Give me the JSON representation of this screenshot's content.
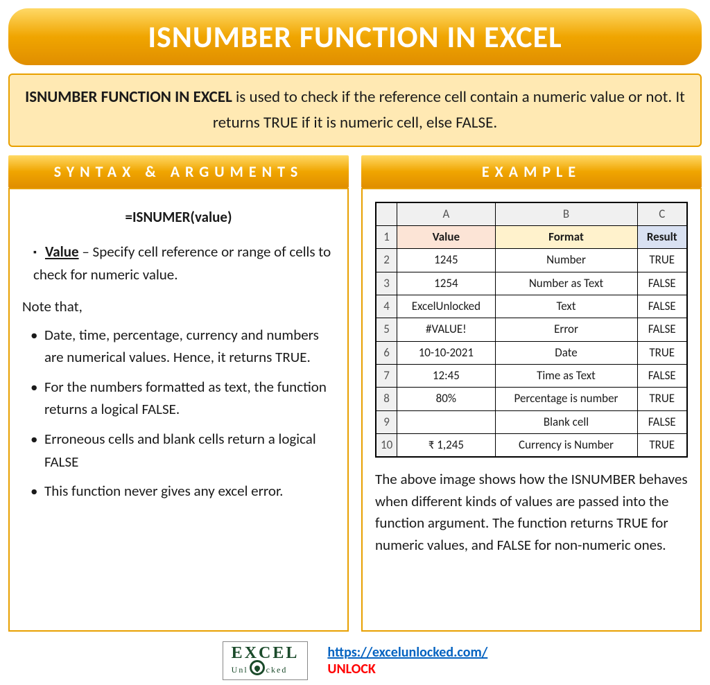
{
  "title": "ISNUMBER FUNCTION IN EXCEL",
  "description": {
    "lead": "ISNUMBER FUNCTION IN EXCEL",
    "rest": " is used to check if the reference cell contain a numeric value or not. It returns TRUE if it is numeric cell, else FALSE."
  },
  "syntax": {
    "header": "SYNTAX & ARGUMENTS",
    "formula": "=ISNUMER(value)",
    "arg_name": "Value",
    "arg_desc": " – Specify cell reference or range of cells to check for numeric value.",
    "note_label": "Note that,",
    "notes": [
      "Date, time, percentage, currency and numbers are numerical values. Hence, it returns TRUE.",
      "For the numbers formatted as text, the function returns a logical FALSE.",
      "Erroneous cells and blank cells return a logical FALSE",
      "This function never gives any excel error."
    ]
  },
  "example": {
    "header": "EXAMPLE",
    "cols": [
      "A",
      "B",
      "C"
    ],
    "headers": [
      "Value",
      "Format",
      "Result"
    ],
    "rows": [
      {
        "n": "2",
        "a": "1245",
        "b": "Number",
        "c": "TRUE"
      },
      {
        "n": "3",
        "a": "1254",
        "b": "Number as Text",
        "c": "FALSE"
      },
      {
        "n": "4",
        "a": "ExcelUnlocked",
        "b": "Text",
        "c": "FALSE"
      },
      {
        "n": "5",
        "a": "#VALUE!",
        "b": "Error",
        "c": "FALSE"
      },
      {
        "n": "6",
        "a": "10-10-2021",
        "b": "Date",
        "c": "TRUE"
      },
      {
        "n": "7",
        "a": "12:45",
        "b": "Time as Text",
        "c": "FALSE"
      },
      {
        "n": "8",
        "a": "80%",
        "b": "Percentage is number",
        "c": "TRUE"
      },
      {
        "n": "9",
        "a": "",
        "b": "Blank cell",
        "c": "FALSE"
      },
      {
        "n": "10",
        "a": "₹ 1,245",
        "b": "Currency is Number",
        "c": "TRUE"
      }
    ],
    "caption": "The above image shows how the ISNUMBER behaves when different kinds of values are passed into the function argument. The function returns TRUE for numeric values, and FALSE for non-numeric ones."
  },
  "footer": {
    "logo_main": "EXCEL",
    "logo_sub": "Unlocked",
    "url": "https://excelunlocked.com/",
    "unlock": "UNLOCK"
  }
}
